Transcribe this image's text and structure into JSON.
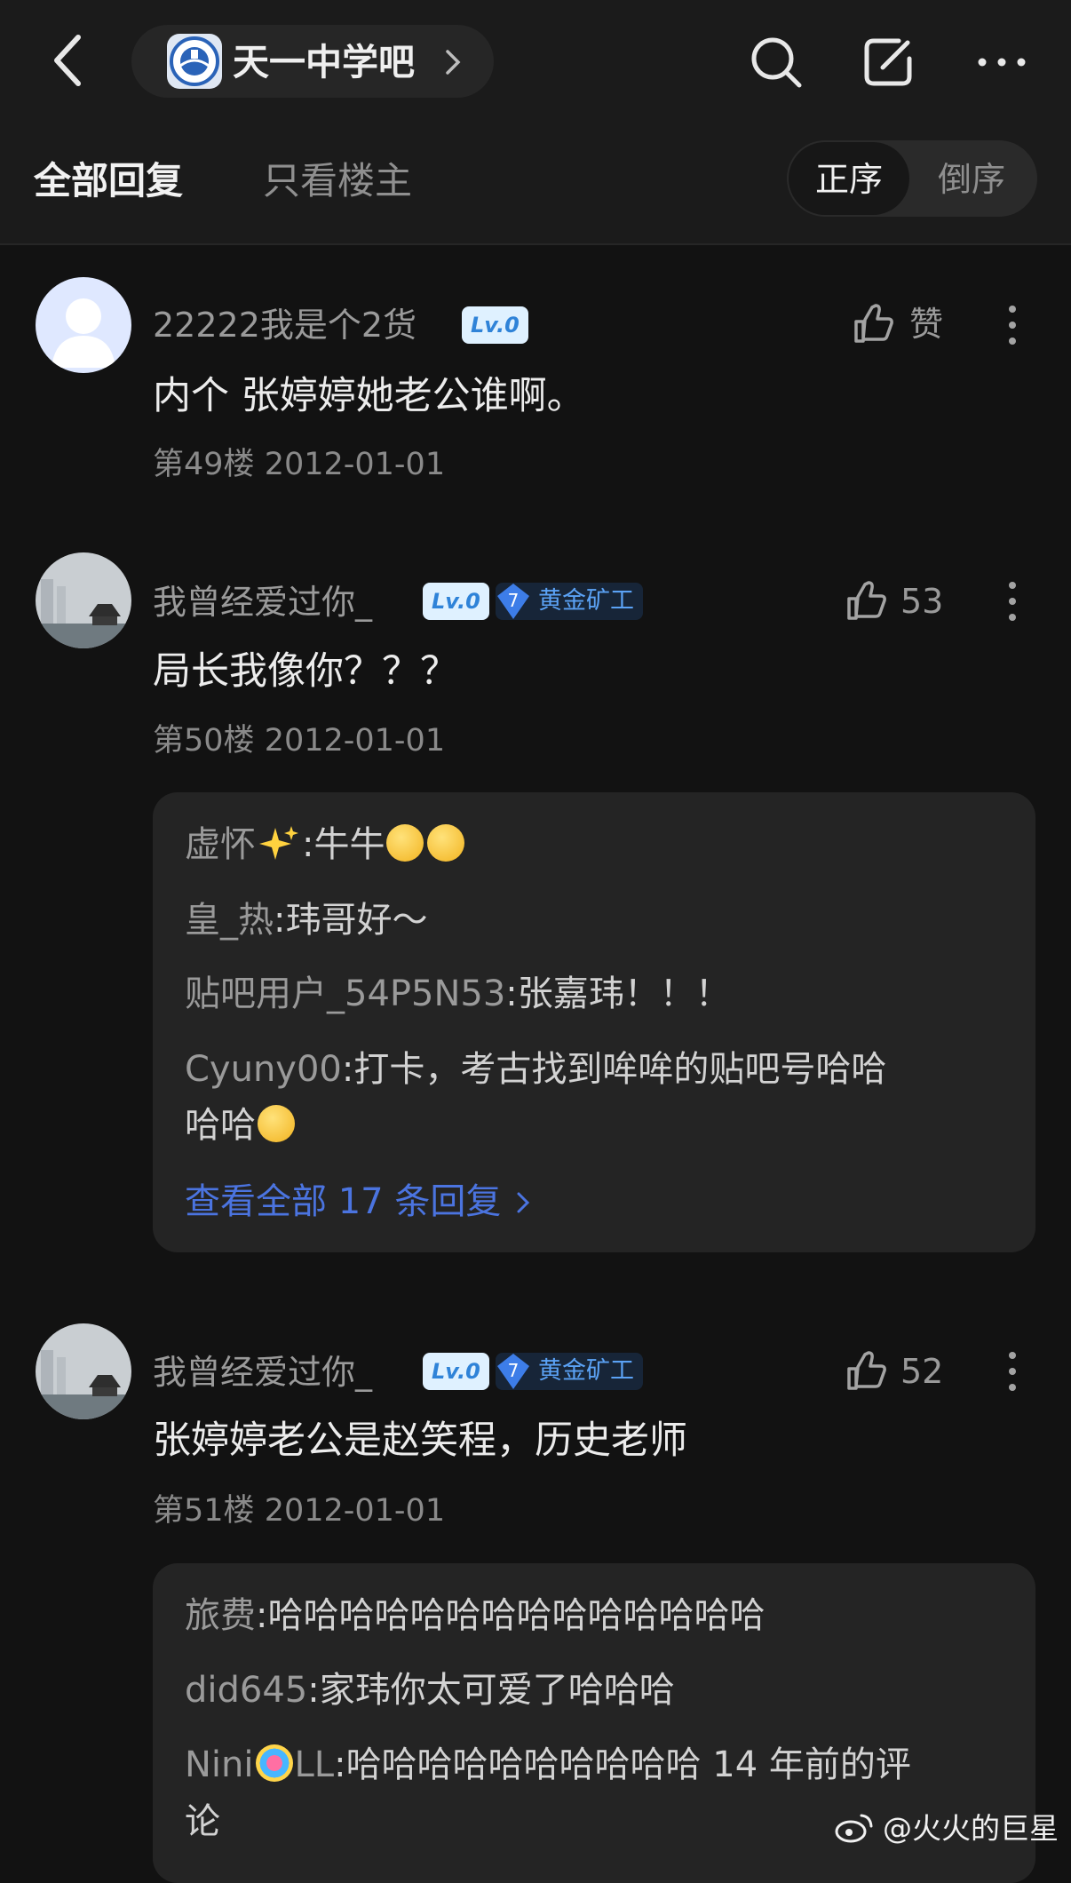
{
  "header": {
    "forum_name": "天一中学吧",
    "icons": [
      "back-arrow-icon",
      "forum-logo",
      "chevron-right-icon",
      "search-icon",
      "compose-icon",
      "more-horizontal-icon"
    ]
  },
  "tabs": {
    "all_replies": "全部回复",
    "op_only": "只看楼主",
    "sort_asc": "正序",
    "sort_desc": "倒序",
    "active_sort": "正序"
  },
  "posts": [
    {
      "username": "22222我是个2货",
      "level": "Lv.0",
      "title_badge": null,
      "like_label": "赞",
      "content": "内个 张婷婷她老公谁啊。",
      "floor": "第49楼",
      "date": "2012-01-01"
    },
    {
      "username": "我曾经爱过你_",
      "level": "Lv.0",
      "title_badge_level": "7",
      "title_badge": "黄金矿工",
      "like_label": "53",
      "content": "局长我像你？？？",
      "floor": "第50楼",
      "date": "2012-01-01",
      "replies": [
        {
          "user": "虚怀",
          "sep": ":",
          "text": "牛牛"
        },
        {
          "user": "皇_热",
          "sep": ":",
          "text": "玮哥好～"
        },
        {
          "user": "贴吧用户_54P5N53",
          "sep": ":",
          "text": "张嘉玮！！！"
        },
        {
          "user": "Cyuny00",
          "sep": ":",
          "text": "打卡，考古找到哞哞的贴吧号哈哈",
          "text2": "哈哈"
        }
      ],
      "view_all": "查看全部 17 条回复"
    },
    {
      "username": "我曾经爱过你_",
      "level": "Lv.0",
      "title_badge_level": "7",
      "title_badge": "黄金矿工",
      "like_label": "52",
      "content": "张婷婷老公是赵笑程，历史老师",
      "floor": "第51楼",
      "date": "2012-01-01",
      "replies": [
        {
          "user": "旅费",
          "sep": ":",
          "text": "哈哈哈哈哈哈哈哈哈哈哈哈哈哈"
        },
        {
          "user": "did645",
          "sep": ":",
          "text": "家玮你太可爱了哈哈哈"
        },
        {
          "user": "Nini",
          "user2": "LL",
          "sep": ":",
          "text": "哈哈哈哈哈哈哈哈哈哈 14 年前的评",
          "text2": "论"
        }
      ]
    }
  ],
  "watermark": "@火火的巨星",
  "colors": {
    "background": "#121212",
    "bar": "#1b1b1b",
    "reply_box": "#242424",
    "link_blue": "#4b74e0",
    "level_badge": "#dff1ff"
  }
}
